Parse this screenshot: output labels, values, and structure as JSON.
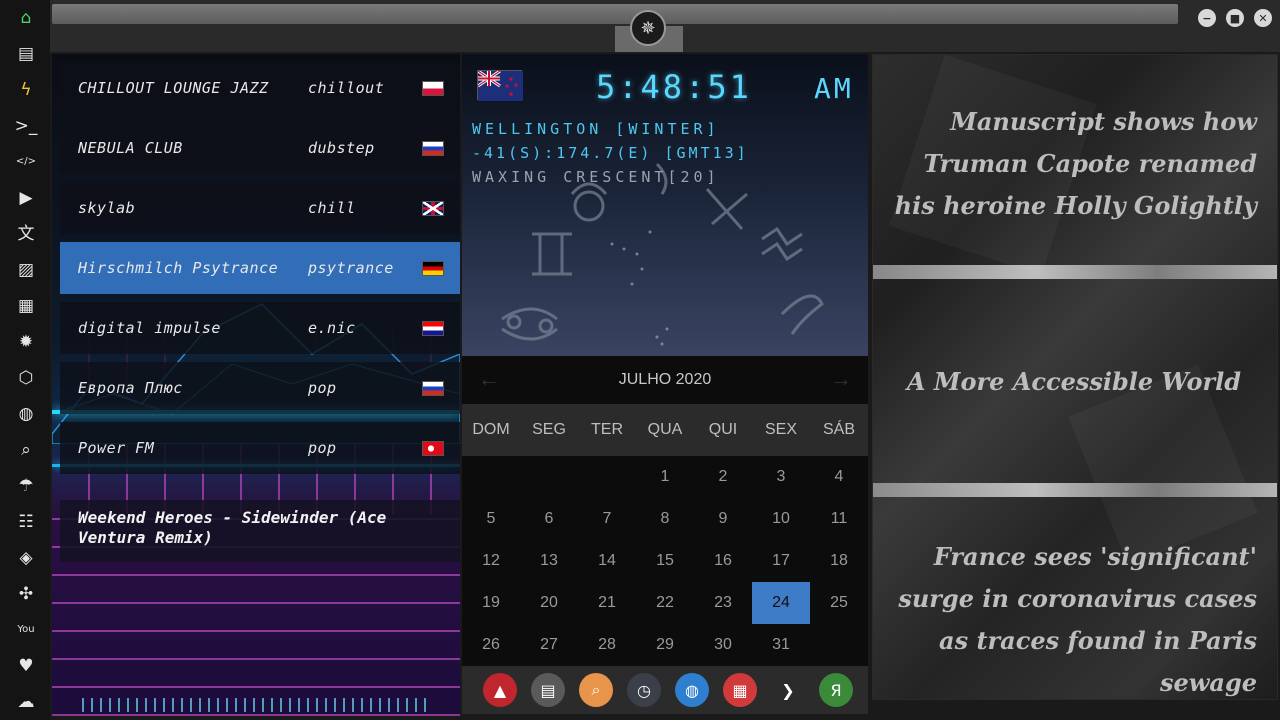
{
  "rail": {
    "items": [
      {
        "icon": "home-icon",
        "glyph": "⌂"
      },
      {
        "icon": "document-icon",
        "glyph": "▤"
      },
      {
        "icon": "lightning-icon",
        "glyph": "ϟ"
      },
      {
        "icon": "terminal-icon",
        "glyph": ">_"
      },
      {
        "icon": "code-icon",
        "glyph": "</>"
      },
      {
        "icon": "play-icon",
        "glyph": "▶"
      },
      {
        "icon": "translate-icon",
        "glyph": "文"
      },
      {
        "icon": "image-icon",
        "glyph": "▨"
      },
      {
        "icon": "newspaper-icon",
        "glyph": "▦"
      },
      {
        "icon": "settings-icon",
        "glyph": "✹"
      },
      {
        "icon": "cube-icon",
        "glyph": "⬡"
      },
      {
        "icon": "globe-icon",
        "glyph": "◍"
      },
      {
        "icon": "search-icon",
        "glyph": "⌕"
      },
      {
        "icon": "umbrella-icon",
        "glyph": "☂"
      },
      {
        "icon": "contacts-icon",
        "glyph": "☷"
      },
      {
        "icon": "ticket-icon",
        "glyph": "◈"
      },
      {
        "icon": "expand-icon",
        "glyph": "✣"
      },
      {
        "icon": "youtube-icon",
        "glyph": "You"
      },
      {
        "icon": "heart-icon",
        "glyph": "♥"
      },
      {
        "icon": "cloud-icon",
        "glyph": "☁"
      }
    ]
  },
  "window": {
    "emblem_glyph": "✵",
    "minimize": "−",
    "maximize": "■",
    "close": "✕"
  },
  "radio": {
    "stations": [
      {
        "name": "CHILLOUT LOUNGE JAZZ",
        "genre": "chillout",
        "flag": "pl"
      },
      {
        "name": "NEBULA CLUB",
        "genre": "dubstep",
        "flag": "ru"
      },
      {
        "name": "skylab",
        "genre": "chill",
        "flag": "gb"
      },
      {
        "name": "Hirschmilch Psytrance",
        "genre": "psytrance",
        "flag": "de"
      },
      {
        "name": "digital impulse",
        "genre": "e.nic",
        "flag": "hr"
      },
      {
        "name": "Европа Плюс",
        "genre": "pop",
        "flag": "ru"
      },
      {
        "name": "Power FM",
        "genre": "pop",
        "flag": "tr"
      }
    ],
    "selected_index": 3,
    "now_playing": "Weekend Heroes - Sidewinder (Ace Ventura Remix)"
  },
  "clock": {
    "time": "5:48:51",
    "ampm": "AM",
    "city": "WELLINGTON [WINTER]",
    "coords": "-41(S):174.7(E) [GMT13]",
    "moon": "WAXING CRESCENT[20]"
  },
  "calendar": {
    "month": "JULHO 2020",
    "prev": "←",
    "next": "→",
    "weekdays": [
      "DOM",
      "SEG",
      "TER",
      "QUA",
      "QUI",
      "SEX",
      "SÁB"
    ],
    "first_weekday_index": 3,
    "days_in_month": 31,
    "today": 24
  },
  "dock": {
    "items": [
      {
        "icon": "app-launcher-icon",
        "glyph": "▲",
        "color": "#c0262d"
      },
      {
        "icon": "news-reader-icon",
        "glyph": "▤",
        "color": "#5a5a5a"
      },
      {
        "icon": "search-app-icon",
        "glyph": "⌕",
        "color": "#e8944a"
      },
      {
        "icon": "clock-app-icon",
        "glyph": "◷",
        "color": "#3a3f4a"
      },
      {
        "icon": "browser-globe-icon",
        "glyph": "◍",
        "color": "#2f7fd0"
      },
      {
        "icon": "calendar-app-icon",
        "glyph": "▦",
        "color": "#d03a3a"
      },
      {
        "icon": "arrow-app-icon",
        "glyph": "❯",
        "color": "#2b2b2b"
      },
      {
        "icon": "yandex-icon",
        "glyph": "Я",
        "color": "#3a8a3a"
      }
    ]
  },
  "news": {
    "headline_1": "Manuscript shows how Truman Capote renamed his heroine Holly Golightly",
    "headline_2": "A More Accessible World",
    "headline_3": "France sees 'significant' surge in coronavirus cases as traces found in Paris sewage"
  }
}
